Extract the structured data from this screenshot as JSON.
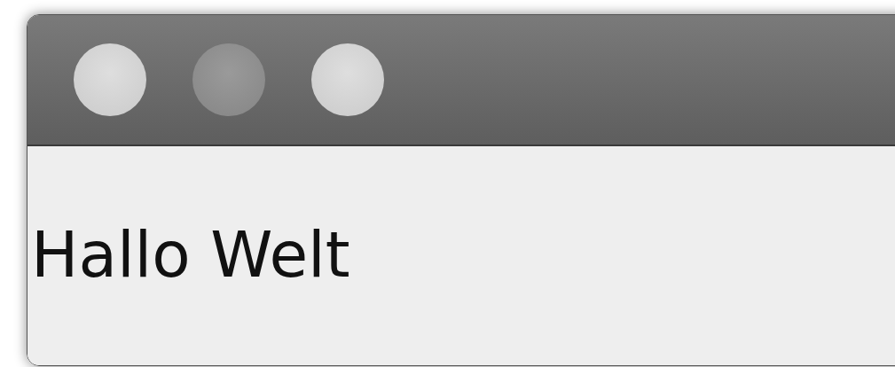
{
  "window": {
    "controls": [
      {
        "dimmed": false
      },
      {
        "dimmed": true
      },
      {
        "dimmed": false
      }
    ]
  },
  "content": {
    "label": "Hallo Welt"
  }
}
